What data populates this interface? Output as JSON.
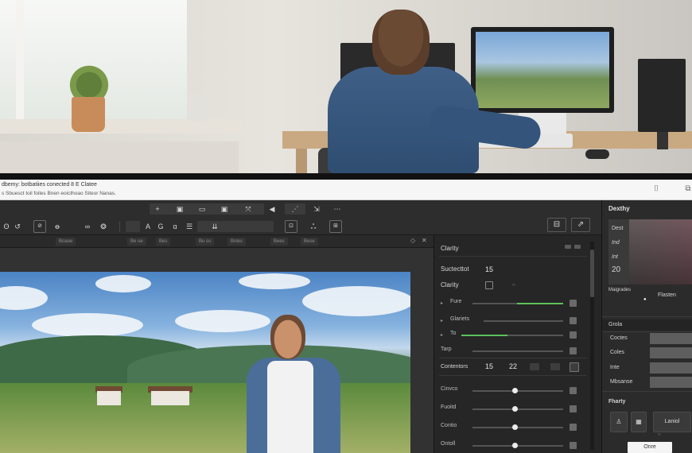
{
  "header": {
    "title": "dbemy: botbatiies conected 8 E Clatee",
    "subtitle": "s Sbuesct toil foiles Bnen eoicthoao Siteor Nanas."
  },
  "toolbar": {
    "row1": [
      "+",
      "▣",
      "▭",
      "▣",
      "⤧",
      "◀",
      "⋰",
      "⇲",
      "⋯"
    ],
    "row1_labels": [
      "ʘ",
      "↺",
      "⊘",
      "ꝋ",
      "∞",
      "❂",
      "ɑ",
      "☰"
    ],
    "row2_labels": [
      "A",
      "G",
      "⇊"
    ],
    "panel_icons": [
      "⊡",
      "ஃ",
      "⊞",
      "⊟",
      "⇗"
    ]
  },
  "subbar": {
    "items": [
      "Boaoe",
      "Be oe",
      "Bes",
      "Bu os",
      "Boles",
      "Bees",
      "Bese"
    ],
    "controls": [
      "◇",
      "✕"
    ]
  },
  "adjust": {
    "title": "Clarity",
    "subtitle": "Suctecttot",
    "subtitle_val": "15",
    "clarity_label": "Clarity",
    "rows": [
      {
        "label": "Fure",
        "value": 0.82
      },
      {
        "label": "Glariets",
        "value": 0.0
      },
      {
        "label": "To",
        "value": 0.45
      },
      {
        "label": "Tarp",
        "value": 0.0
      }
    ],
    "counter_label": "Contentors",
    "counter_a": "15",
    "counter_b": "22",
    "sliders": [
      {
        "label": "Cinvco",
        "value": 0.5
      },
      {
        "label": "Fuoitd",
        "value": 0.5
      },
      {
        "label": "Contio",
        "value": 0.5
      },
      {
        "label": "Ontoll",
        "value": 0.5
      }
    ]
  },
  "right": {
    "title": "Dexthy",
    "stack_lines": [
      "Dest",
      "Ind",
      "Int"
    ],
    "stack_value": "20",
    "caption_left": "Maigrades",
    "caption_right": "Flasten",
    "group_title": "Grola",
    "group_rows": [
      "Coctes",
      "Coles",
      "Inte",
      "Mbsanse"
    ],
    "tiles_title": "Fharty",
    "tile_label": "Laniol",
    "ok_label": "Onre"
  }
}
